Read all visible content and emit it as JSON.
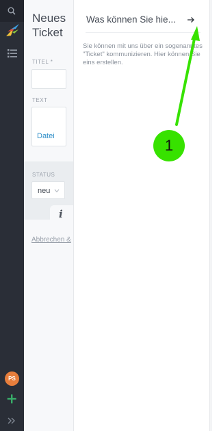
{
  "form": {
    "title": "Neues Ticket",
    "title_label": "TITEL *",
    "text_label": "TEXT",
    "file_link": "Datei",
    "status_label": "STATUS",
    "status_value": "neu",
    "info_glyph": "i",
    "cancel_link": "Abbrechen &"
  },
  "help": {
    "headline": "Was können Sie hie...",
    "description": "Sie können mit uns über ein sogenanntes \"Ticket\" kommunizieren. Hier können Sie eins erstellen."
  },
  "user": {
    "initials": "PS"
  },
  "annotation": {
    "number": "1",
    "color": "#37e200"
  },
  "icons": {
    "search": "search-icon",
    "logo": "zammad-logo-icon",
    "overview": "overview-list-icon",
    "plus": "plus-icon",
    "expand": "double-chevron-right-icon",
    "arrow": "arrow-right-icon",
    "chevron": "chevron-down-icon"
  },
  "colors": {
    "rail": "#2a2e37",
    "link": "#2e8ec8",
    "avatar": "#e77e3c",
    "plus": "#38ad69"
  }
}
